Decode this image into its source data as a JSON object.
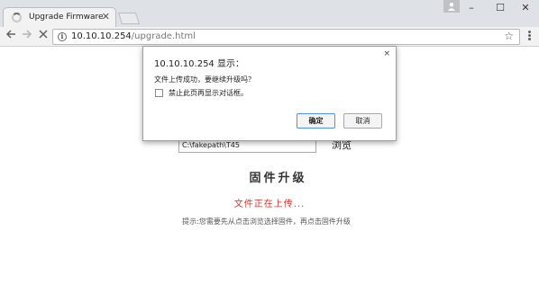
{
  "browser": {
    "tab_title": "Upgrade Firmware",
    "tab_close": "✕",
    "window_controls": {
      "minimize": "–",
      "maximize": "☐",
      "close": "✕"
    },
    "url_host": "10.10.10.254",
    "url_path": "/upgrade.html",
    "icons": {
      "back": "arrow-left-icon",
      "forward": "arrow-right-icon",
      "stop": "close-icon",
      "info": "info-icon",
      "star": "star-icon",
      "menu": "kebab-menu-icon",
      "user": "user-icon"
    }
  },
  "dialog": {
    "title": "10.10.10.254 显示：",
    "message": "文件上传成功，要继续升级吗？",
    "checkbox_label": "禁止此页再显示对话框。",
    "checkbox_checked": false,
    "ok_label": "确定",
    "cancel_label": "取消",
    "close": "×"
  },
  "page": {
    "file_path": "C:\\fakepath\\T45",
    "browse_label": "浏览",
    "heading": "固件升级",
    "status": "文件正在上传...",
    "hint": "提示:您需要先从点击浏览选择固件，再点击固件升级"
  },
  "colors": {
    "status": "#e0312b",
    "dialog_ok_border": "#4d90fe"
  }
}
